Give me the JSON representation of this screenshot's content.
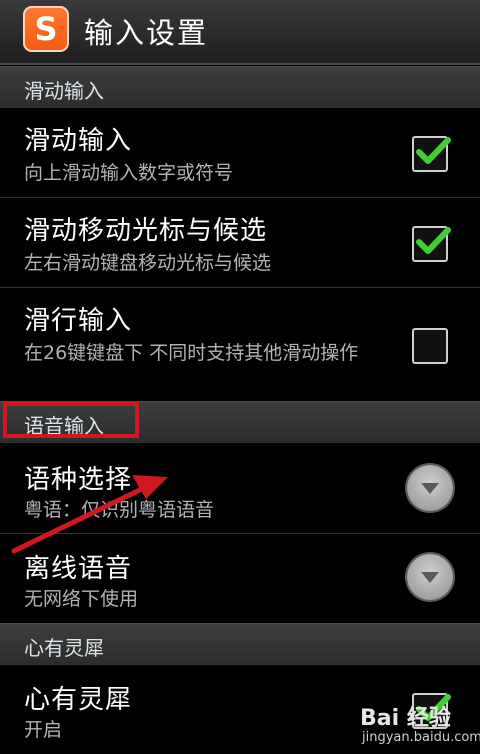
{
  "header": {
    "icon_letter": "S",
    "title": "输入设置"
  },
  "sections": [
    {
      "label": "滑动输入"
    },
    {
      "label": "语音输入"
    },
    {
      "label": "心有灵犀"
    }
  ],
  "rows": [
    {
      "title": "滑动输入",
      "subtitle": "向上滑动输入数字或符号",
      "control": "checkbox",
      "checked": true
    },
    {
      "title": "滑动移动光标与候选",
      "subtitle": "左右滑动键盘移动光标与候选",
      "control": "checkbox",
      "checked": true
    },
    {
      "title": "滑行输入",
      "subtitle": "在26键键盘下 不同时支持其他滑动操作",
      "control": "checkbox",
      "checked": false
    },
    {
      "title": "语种选择",
      "subtitle": "粤语：仅识别粤语语音",
      "control": "dropdown"
    },
    {
      "title": "离线语音",
      "subtitle": "无网络下使用",
      "control": "dropdown"
    },
    {
      "title": "心有灵犀",
      "subtitle": "开启",
      "control": "checkbox",
      "checked": true
    }
  ],
  "watermark": {
    "text": "Bai 经验",
    "sub": "jingyan.baidu.com"
  },
  "colors": {
    "check": "#3fcf2e",
    "highlight": "#d01820",
    "accent_icon": "#f25a12"
  }
}
